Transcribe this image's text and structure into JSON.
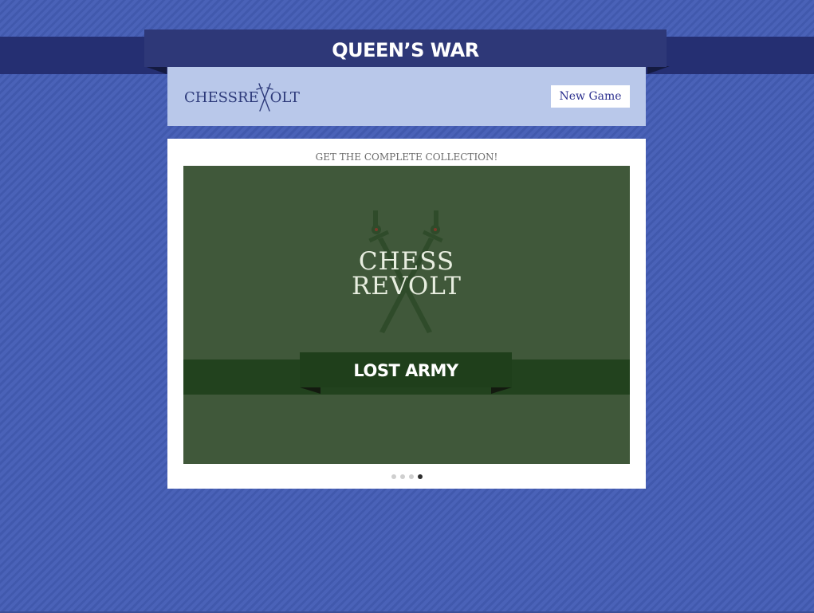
{
  "banner": {
    "title": "QUEEN’S WAR"
  },
  "header": {
    "logo_left": "CHESSRE",
    "logo_right": "OLT",
    "new_game_label": "New Game"
  },
  "promo": {
    "heading": "GET THE COMPLETE COLLECTION!",
    "logo_line1": "CHESS",
    "logo_line2": "REVOLT",
    "ribbon_title": "LOST ARMY"
  },
  "carousel": {
    "total_slides": 4,
    "active_slide": 4
  },
  "colors": {
    "background": "#4a62b8",
    "banner": "#2e3878",
    "header": "#b9c8ea",
    "promo_bg": "#40583a",
    "promo_ribbon": "#1f3f1b"
  }
}
